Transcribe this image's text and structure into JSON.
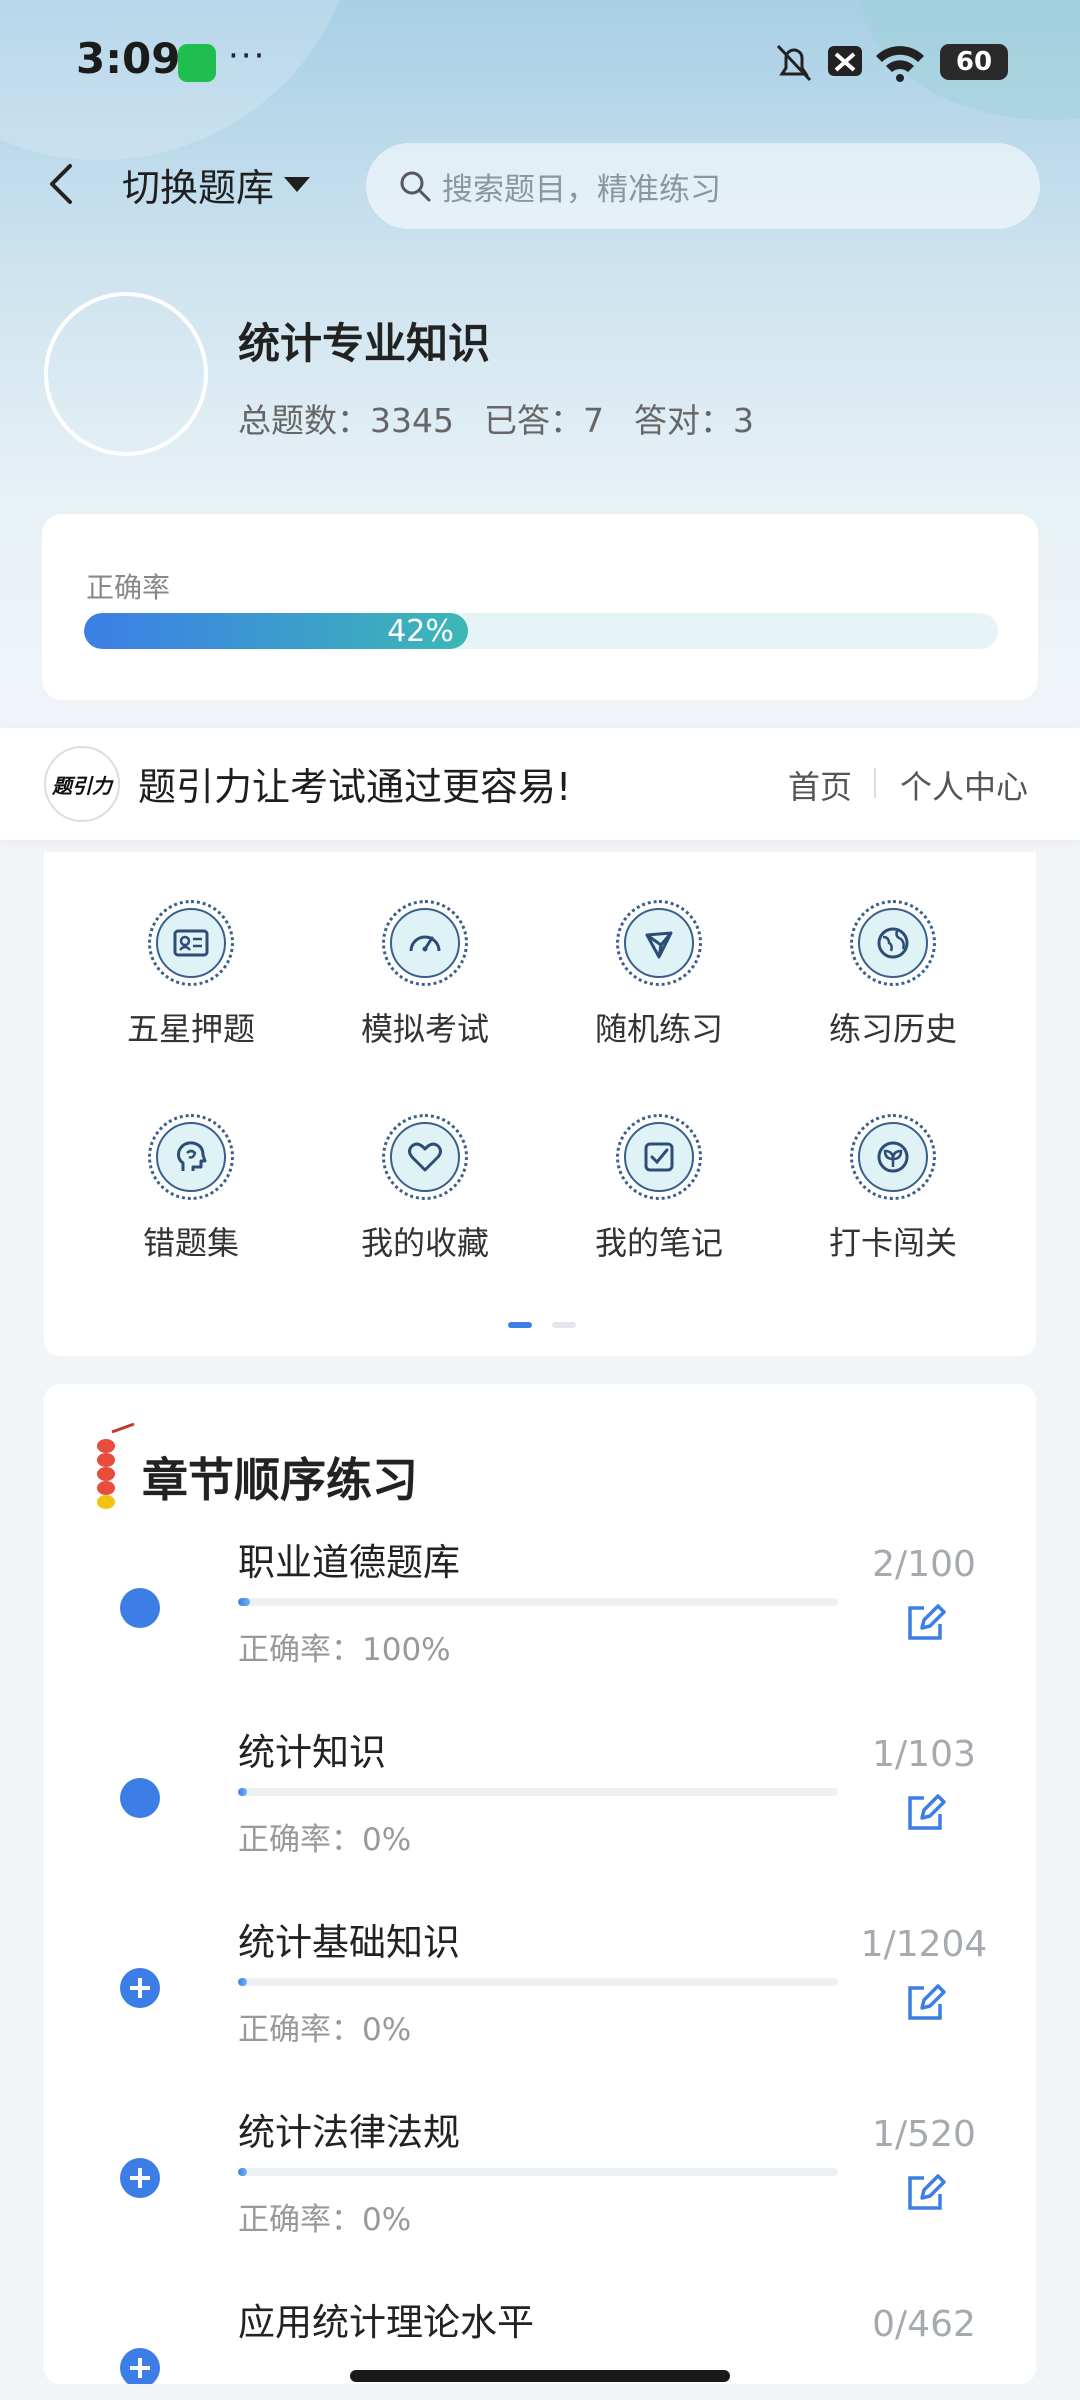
{
  "status_bar": {
    "time": "3:09",
    "dots": "···",
    "battery": "60"
  },
  "header": {
    "bank_switch_label": "切换题库",
    "search_placeholder": "搜索题目，精准练习"
  },
  "profile": {
    "bank_name": "统计专业知识",
    "total_label": "总题数：3345",
    "answered_label": "已答：7",
    "correct_label": "答对：3"
  },
  "accuracy": {
    "label": "正确率",
    "value_text": "42%",
    "value": 0.42
  },
  "banner": {
    "logo_text": "题引力",
    "slogan": "题引力让考试通过更容易!",
    "nav_home": "首页",
    "nav_user": "个人中心"
  },
  "grid": {
    "items": [
      {
        "label": "五星押题",
        "icon": "id-card-icon"
      },
      {
        "label": "模拟考试",
        "icon": "speedometer-icon"
      },
      {
        "label": "随机练习",
        "icon": "network-icon"
      },
      {
        "label": "练习历史",
        "icon": "globe-icon"
      },
      {
        "label": "错题集",
        "icon": "brain-icon"
      },
      {
        "label": "我的收藏",
        "icon": "heart-icon"
      },
      {
        "label": "我的笔记",
        "icon": "note-check-icon"
      },
      {
        "label": "打卡闯关",
        "icon": "sprout-icon"
      }
    ],
    "page": 1,
    "pages": 2
  },
  "chapters": {
    "title": "章节顺序练习",
    "items": [
      {
        "name": "职业道德题库",
        "count": "2/100",
        "accuracy": "正确率：100%",
        "progress": 0.02,
        "marker": "dot"
      },
      {
        "name": "统计知识",
        "count": "1/103",
        "accuracy": "正确率：0%",
        "progress": 0.01,
        "marker": "dot"
      },
      {
        "name": "统计基础知识",
        "count": "1/1204",
        "accuracy": "正确率：0%",
        "progress": 0.001,
        "marker": "plus"
      },
      {
        "name": "统计法律法规",
        "count": "1/520",
        "accuracy": "正确率：0%",
        "progress": 0.002,
        "marker": "plus"
      },
      {
        "name": "应用统计理论水平",
        "count": "0/462",
        "accuracy": "",
        "progress": 0,
        "marker": "plus"
      }
    ]
  },
  "colors": {
    "accent": "#3c7ee6",
    "teal": "#3cb7b6",
    "icon_stroke": "#3a5f8c"
  }
}
